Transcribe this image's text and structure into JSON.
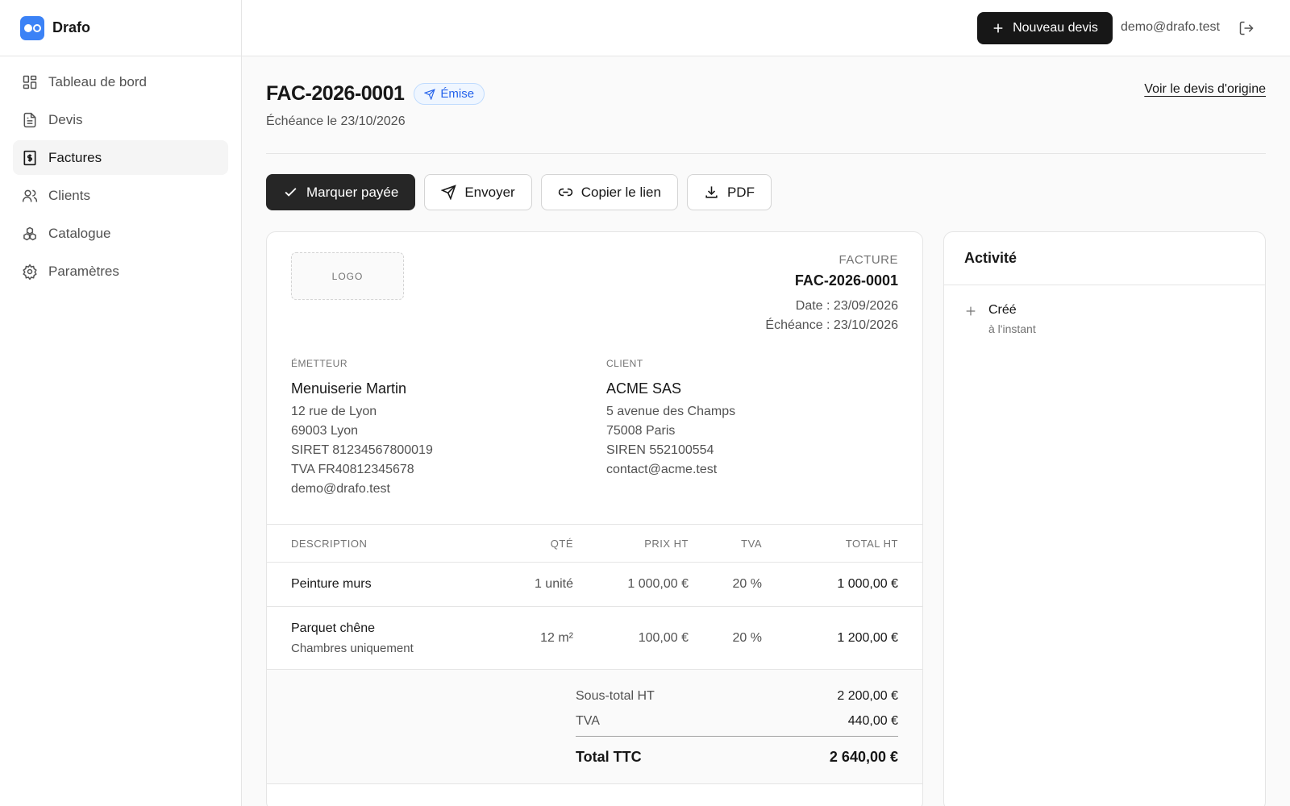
{
  "app": {
    "name": "Drafo"
  },
  "sidebar": {
    "items": [
      {
        "label": "Tableau de bord",
        "icon": "dashboard-icon",
        "active": false
      },
      {
        "label": "Devis",
        "icon": "file-text-icon",
        "active": false
      },
      {
        "label": "Factures",
        "icon": "receipt-icon",
        "active": true
      },
      {
        "label": "Clients",
        "icon": "users-icon",
        "active": false
      },
      {
        "label": "Catalogue",
        "icon": "boxes-icon",
        "active": false
      },
      {
        "label": "Paramètres",
        "icon": "gear-icon",
        "active": false
      }
    ]
  },
  "topbar": {
    "new_quote_label": "Nouveau devis",
    "user_email": "demo@drafo.test"
  },
  "header": {
    "title": "FAC-2026-0001",
    "status": "Émise",
    "due_text": "Échéance le 23/10/2026",
    "origin_link": "Voir le devis d'origine"
  },
  "actions": {
    "mark_paid": "Marquer payée",
    "send": "Envoyer",
    "copy_link": "Copier le lien",
    "pdf": "PDF"
  },
  "invoice": {
    "logo_placeholder": "LOGO",
    "kind": "FACTURE",
    "number": "FAC-2026-0001",
    "date": "Date : 23/09/2026",
    "due": "Échéance : 23/10/2026",
    "issuer": {
      "label": "ÉMETTEUR",
      "name": "Menuiserie Martin",
      "lines": [
        "12 rue de Lyon",
        "69003 Lyon",
        "SIRET 81234567800019",
        "TVA FR40812345678",
        "demo@drafo.test"
      ]
    },
    "client": {
      "label": "CLIENT",
      "name": "ACME SAS",
      "lines": [
        "5 avenue des Champs",
        "75008 Paris",
        "SIREN 552100554",
        "contact@acme.test"
      ]
    },
    "columns": {
      "description": "DESCRIPTION",
      "qty": "QTÉ",
      "unit_price": "PRIX HT",
      "vat": "TVA",
      "total": "TOTAL HT"
    },
    "rows": [
      {
        "description": "Peinture murs",
        "note": "",
        "qty": "1 unité",
        "unit_price": "1 000,00 €",
        "vat": "20 %",
        "total": "1 000,00 €"
      },
      {
        "description": "Parquet chêne",
        "note": "Chambres uniquement",
        "qty": "12 m²",
        "unit_price": "100,00 €",
        "vat": "20 %",
        "total": "1 200,00 €"
      }
    ],
    "totals": {
      "subtotal_label": "Sous-total HT",
      "subtotal": "2 200,00 €",
      "vat_label": "TVA",
      "vat": "440,00 €",
      "total_label": "Total TTC",
      "total": "2 640,00 €"
    }
  },
  "activity": {
    "title": "Activité",
    "items": [
      {
        "label": "Créé",
        "time": "à l'instant",
        "icon": "plus-icon"
      }
    ]
  },
  "colors": {
    "brand": "#3b82f6",
    "badge": "#2563eb",
    "primary": "#262626"
  }
}
